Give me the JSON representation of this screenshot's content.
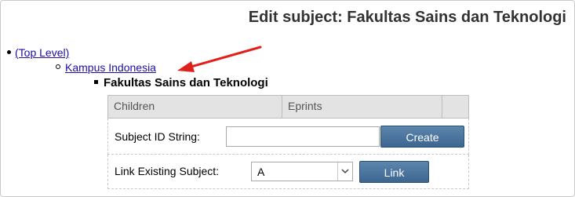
{
  "page": {
    "title": "Edit subject: Fakultas Sains dan Teknologi"
  },
  "tree": {
    "top_level": "(Top Level)",
    "parent": "Kampus Indonesia",
    "current": "Fakultas Sains dan Teknologi"
  },
  "table": {
    "headers": [
      "Children",
      "Eprints",
      ""
    ],
    "subject_id": {
      "label": "Subject ID String:",
      "value": "",
      "button": "Create"
    },
    "link_existing": {
      "label": "Link Existing Subject:",
      "selected": "A",
      "button": "Link"
    }
  },
  "colors": {
    "link": "#1a0dab",
    "button": "#4a739b",
    "arrow": "#e0201a",
    "header_bg": "#e3e3e3"
  },
  "icons": {
    "arrow": "red-arrow-annotation",
    "dropdown": "chevron-down-icon"
  }
}
